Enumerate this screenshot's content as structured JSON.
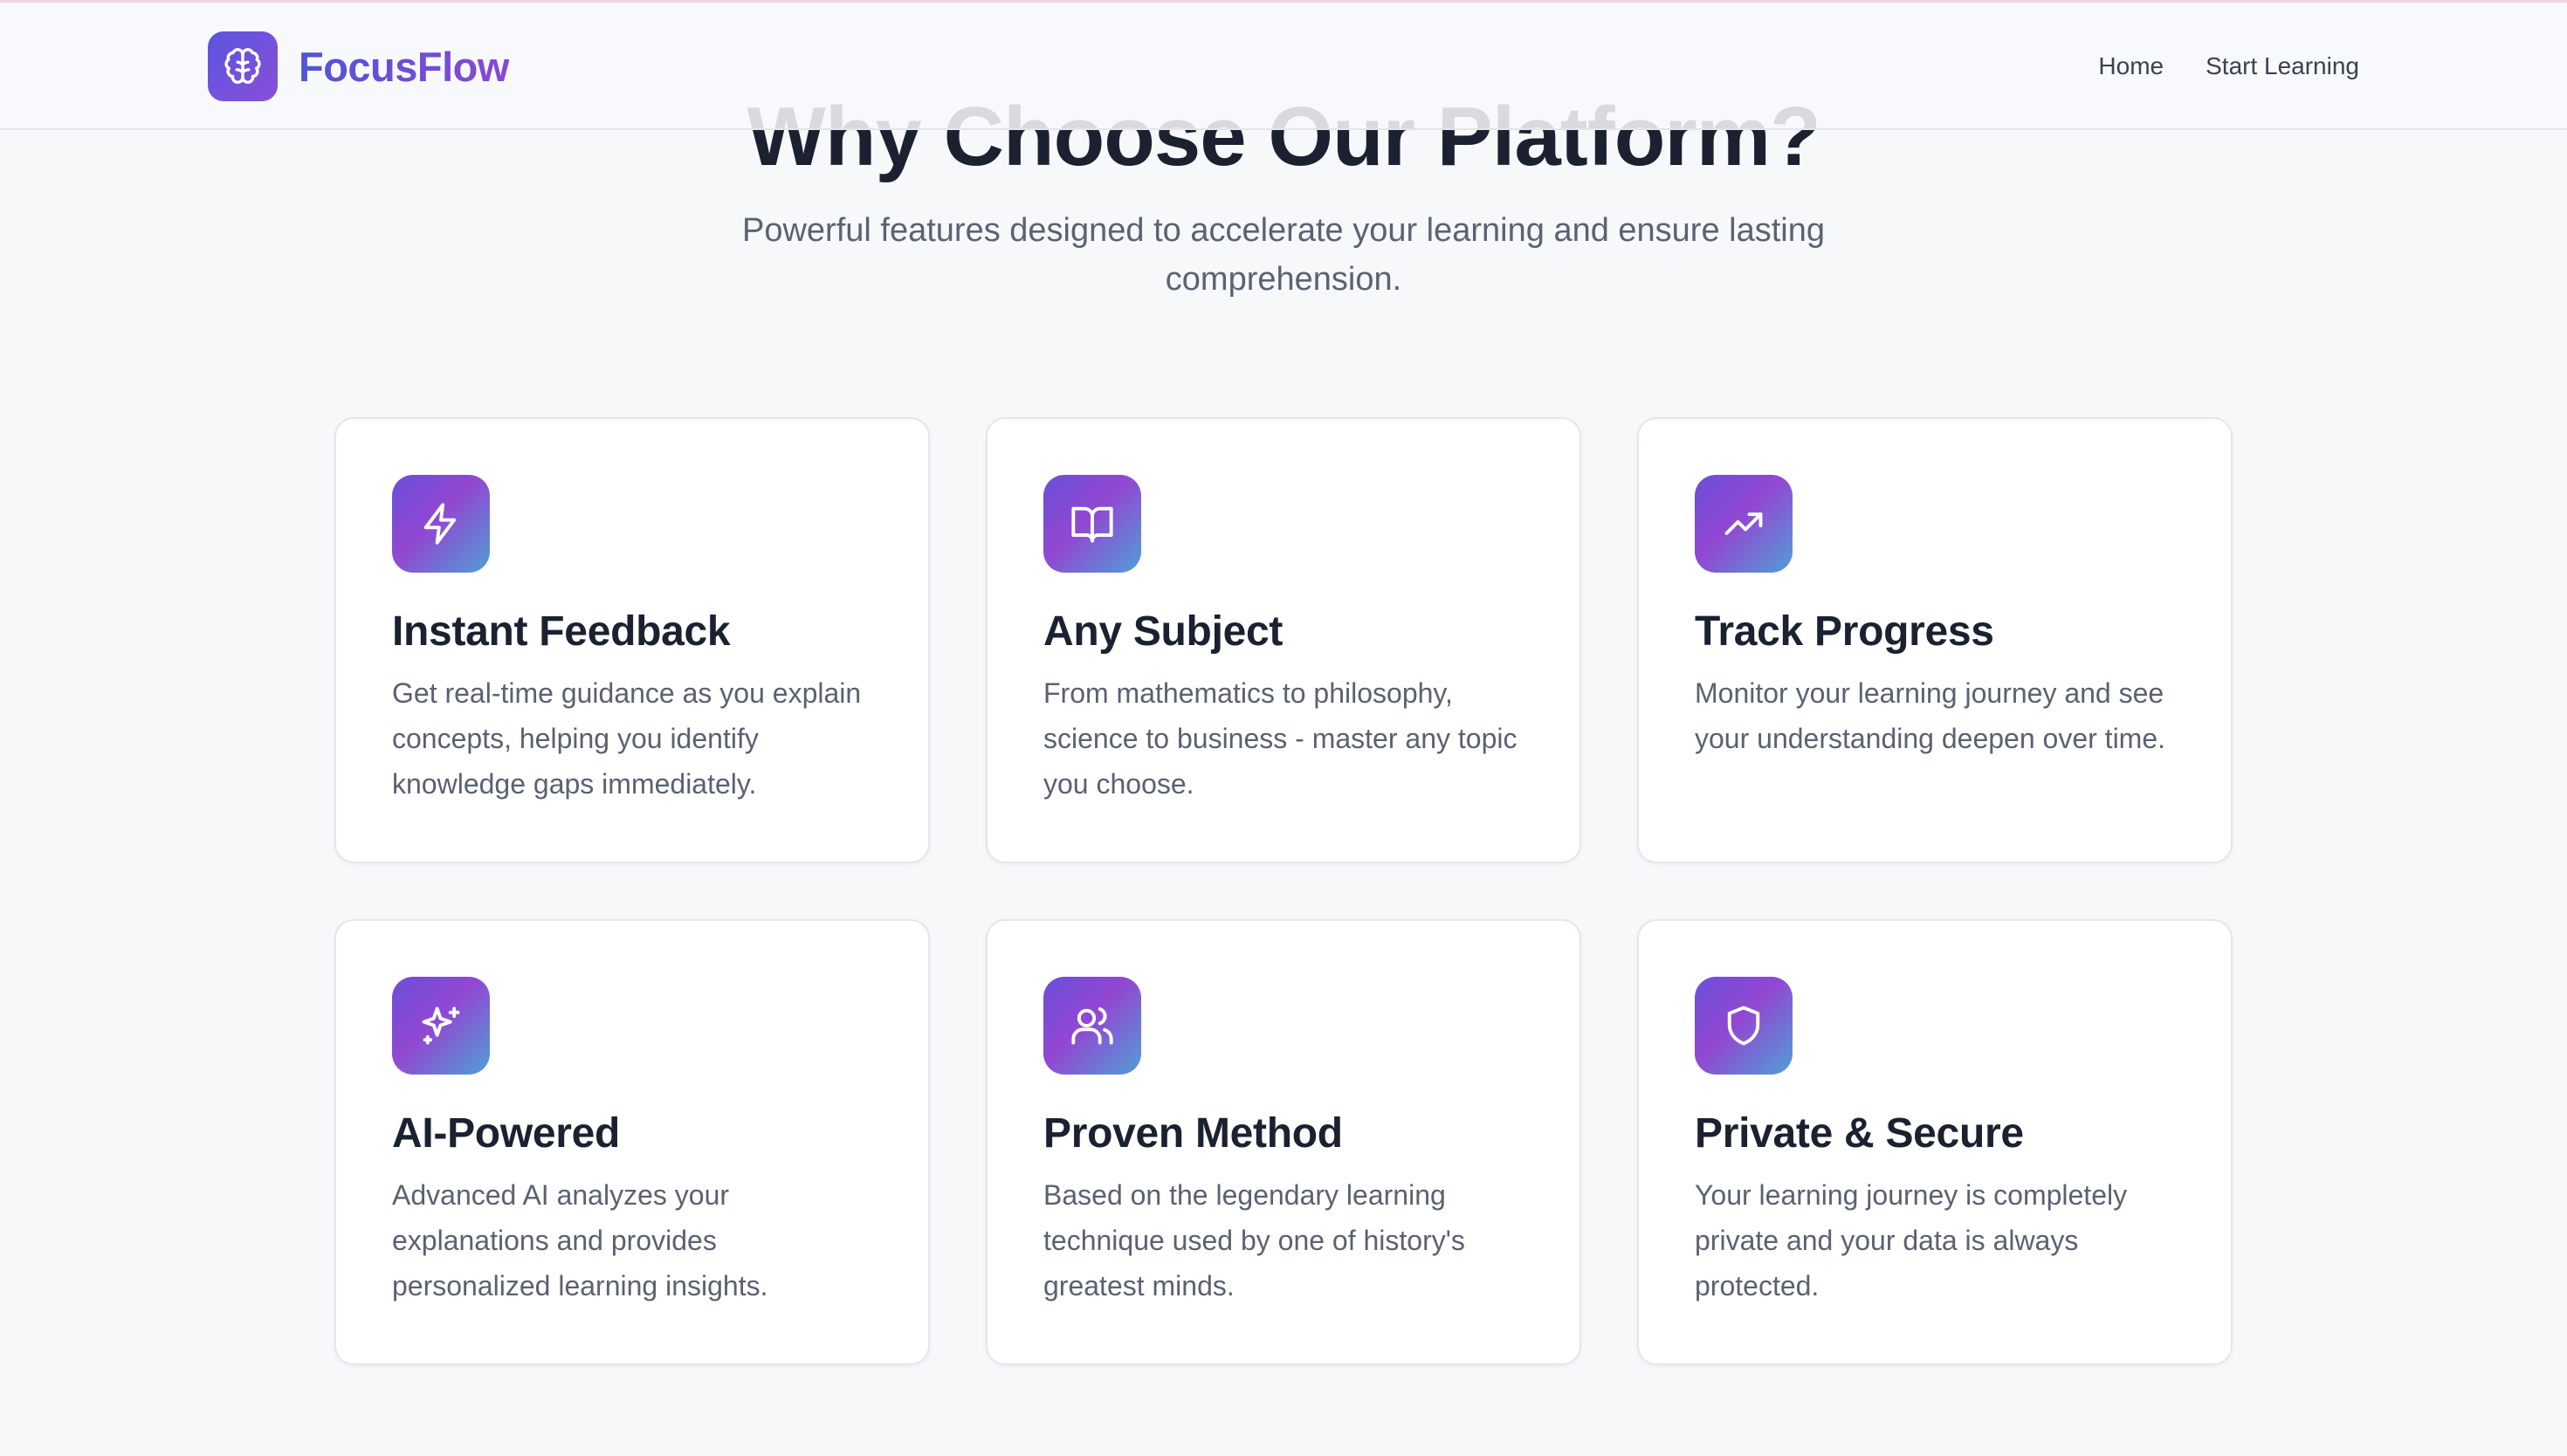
{
  "header": {
    "brand_name": "FocusFlow",
    "brand_icon": "brain-icon",
    "nav": [
      {
        "label": "Home"
      },
      {
        "label": "Start Learning"
      }
    ]
  },
  "section": {
    "title": "Why Choose Our Platform?",
    "subtitle": "Powerful features designed to accelerate your learning and ensure lasting comprehension."
  },
  "features": [
    {
      "icon": "lightning-icon",
      "title": "Instant Feedback",
      "description": "Get real-time guidance as you explain concepts, helping you identify knowledge gaps immediately."
    },
    {
      "icon": "book-open-icon",
      "title": "Any Subject",
      "description": "From mathematics to philosophy, science to business - master any topic you choose."
    },
    {
      "icon": "trending-up-icon",
      "title": "Track Progress",
      "description": "Monitor your learning journey and see your understanding deepen over time."
    },
    {
      "icon": "sparkles-icon",
      "title": "AI-Powered",
      "description": "Advanced AI analyzes your explanations and provides personalized learning insights."
    },
    {
      "icon": "users-icon",
      "title": "Proven Method",
      "description": "Based on the legendary learning technique used by one of history's greatest minds."
    },
    {
      "icon": "shield-icon",
      "title": "Private & Secure",
      "description": "Your learning journey is completely private and your data is always protected."
    }
  ],
  "colors": {
    "accent_start": "#5a55e0",
    "accent_end": "#8a4fd8",
    "icon_gradient": [
      "#6b4fd8",
      "#9247d2",
      "#4f9fd6"
    ],
    "background": "#f7f8fa"
  }
}
